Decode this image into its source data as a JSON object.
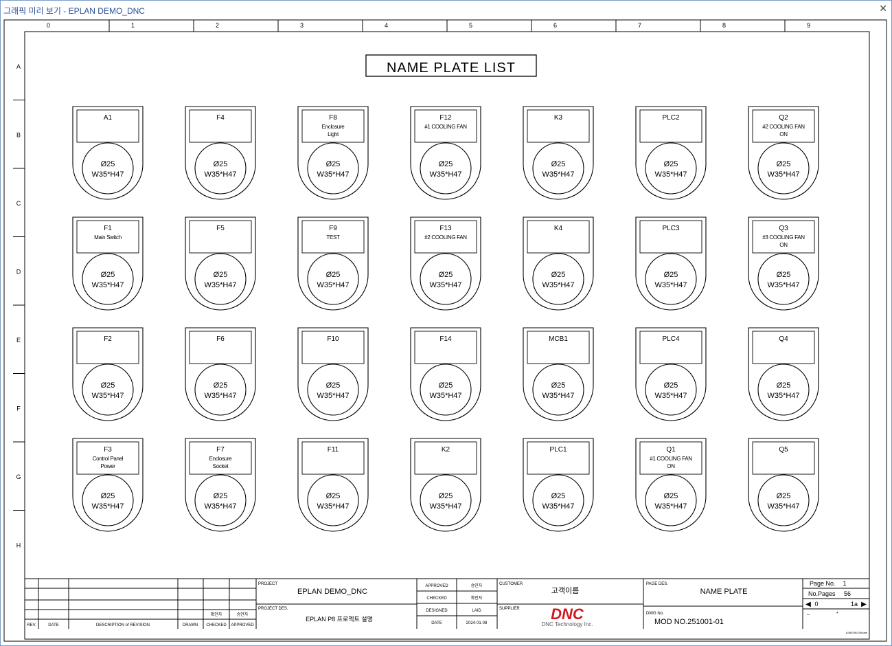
{
  "window": {
    "title": "그래픽 미리 보기 - EPLAN DEMO_DNC",
    "close_icon": "close-icon"
  },
  "frame": {
    "columns": [
      "0",
      "1",
      "2",
      "3",
      "4",
      "5",
      "6",
      "7",
      "8",
      "9"
    ],
    "rows": [
      "A",
      "B",
      "C",
      "D",
      "E",
      "F",
      "G",
      "H"
    ]
  },
  "drawing": {
    "title": "NAME PLATE LIST"
  },
  "plate_size": {
    "dia": "Ø25",
    "dims": "W35*H47"
  },
  "plates": [
    [
      "A1"
    ],
    [
      "F4"
    ],
    [
      "F8",
      "Enclosure",
      "Light"
    ],
    [
      "F12",
      "#1 COOLING FAN"
    ],
    [
      "K3"
    ],
    [
      "PLC2"
    ],
    [
      "Q2",
      "#2 COOLING FAN",
      "ON"
    ],
    [
      "F1",
      "Main Switch"
    ],
    [
      "F5"
    ],
    [
      "F9",
      "TEST"
    ],
    [
      "F13",
      "#2 COOLING FAN"
    ],
    [
      "K4"
    ],
    [
      "PLC3"
    ],
    [
      "Q3",
      "#3 COOLING FAN",
      "ON"
    ],
    [
      "F2"
    ],
    [
      "F6"
    ],
    [
      "F10"
    ],
    [
      "F14"
    ],
    [
      "MCB1"
    ],
    [
      "PLC4"
    ],
    [
      "Q4"
    ],
    [
      "F3",
      "Control Panel",
      "Power"
    ],
    [
      "F7",
      "Enclosure",
      "Socket"
    ],
    [
      "F11"
    ],
    [
      "K2"
    ],
    [
      "PLC1"
    ],
    [
      "Q1",
      "#1 COOLING FAN",
      "ON"
    ],
    [
      "Q5"
    ]
  ],
  "title_block": {
    "rev_headers": [
      "REV.",
      "DATE",
      "DESCRIPTION of REVISION",
      "DRAWN",
      "CHECKED",
      "APPROVED"
    ],
    "checked_sign": "확인자",
    "approved_sign": "승인자",
    "project_label": "PROJECT",
    "project": "EPLAN DEMO_DNC",
    "project_des_label": "PROJECT DES.",
    "project_des": "EPLAN P8 프로젝트 설명",
    "approved_label": "APPROVED",
    "approved_value": "승인자",
    "checked_label": "CHECKED",
    "checked_value": "확인자",
    "designed_label": "DESIGNED",
    "designed_value": "LAID",
    "date_label": "DATE",
    "date_value": "2024-01-08",
    "customer_label": "CUSTOMER",
    "customer": "고객이름",
    "supplier_label": "SUPPLIER",
    "supplier_logo": "DNC",
    "supplier_name": "DNC Technology Inc.",
    "page_des_label": "PAGE DES.",
    "page_des": "NAME PLATE",
    "dwg_label": "DWG No.",
    "dwg_no": "MOD NO.251001-01",
    "page_no_label": "Page No.",
    "page_no": "1",
    "no_pages_label": "No.Pages",
    "no_pages": "56",
    "nav_left": "0",
    "nav_right": "1a",
    "dash": "–",
    "star": "*",
    "small_code": "A3dEDNC/Nolate"
  }
}
